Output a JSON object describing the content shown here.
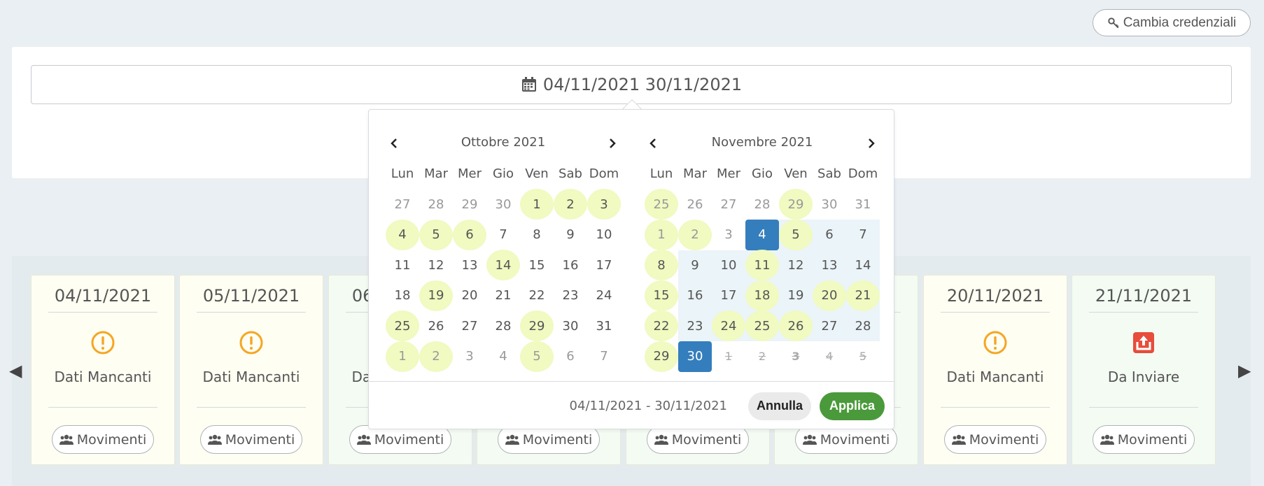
{
  "header": {
    "credentials_label": "Cambia credenziali"
  },
  "date_filter": {
    "value": "04/11/2021 30/11/2021"
  },
  "picker": {
    "left": {
      "title": "Ottobre 2021",
      "weekdays": [
        "Lun",
        "Mar",
        "Mer",
        "Gio",
        "Ven",
        "Sab",
        "Dom"
      ],
      "days": [
        {
          "d": "27",
          "s": "off"
        },
        {
          "d": "28",
          "s": "off"
        },
        {
          "d": "29",
          "s": "off"
        },
        {
          "d": "30",
          "s": "off"
        },
        {
          "d": "1",
          "s": "hl"
        },
        {
          "d": "2",
          "s": "hl"
        },
        {
          "d": "3",
          "s": "hl"
        },
        {
          "d": "4",
          "s": "hl"
        },
        {
          "d": "5",
          "s": "hl"
        },
        {
          "d": "6",
          "s": "hl"
        },
        {
          "d": "7",
          "s": ""
        },
        {
          "d": "8",
          "s": ""
        },
        {
          "d": "9",
          "s": ""
        },
        {
          "d": "10",
          "s": ""
        },
        {
          "d": "11",
          "s": ""
        },
        {
          "d": "12",
          "s": ""
        },
        {
          "d": "13",
          "s": ""
        },
        {
          "d": "14",
          "s": "hl"
        },
        {
          "d": "15",
          "s": ""
        },
        {
          "d": "16",
          "s": ""
        },
        {
          "d": "17",
          "s": ""
        },
        {
          "d": "18",
          "s": ""
        },
        {
          "d": "19",
          "s": "hl"
        },
        {
          "d": "20",
          "s": ""
        },
        {
          "d": "21",
          "s": ""
        },
        {
          "d": "22",
          "s": ""
        },
        {
          "d": "23",
          "s": ""
        },
        {
          "d": "24",
          "s": ""
        },
        {
          "d": "25",
          "s": "hl"
        },
        {
          "d": "26",
          "s": ""
        },
        {
          "d": "27",
          "s": ""
        },
        {
          "d": "28",
          "s": ""
        },
        {
          "d": "29",
          "s": "hl"
        },
        {
          "d": "30",
          "s": ""
        },
        {
          "d": "31",
          "s": ""
        },
        {
          "d": "1",
          "s": "off hl"
        },
        {
          "d": "2",
          "s": "off hl"
        },
        {
          "d": "3",
          "s": "off"
        },
        {
          "d": "4",
          "s": "off"
        },
        {
          "d": "5",
          "s": "off hl"
        },
        {
          "d": "6",
          "s": "off"
        },
        {
          "d": "7",
          "s": "off"
        }
      ]
    },
    "right": {
      "title": "Novembre 2021",
      "weekdays": [
        "Lun",
        "Mar",
        "Mer",
        "Gio",
        "Ven",
        "Sab",
        "Dom"
      ],
      "days": [
        {
          "d": "25",
          "s": "off hl"
        },
        {
          "d": "26",
          "s": "off"
        },
        {
          "d": "27",
          "s": "off"
        },
        {
          "d": "28",
          "s": "off"
        },
        {
          "d": "29",
          "s": "off hl"
        },
        {
          "d": "30",
          "s": "off"
        },
        {
          "d": "31",
          "s": "off"
        },
        {
          "d": "1",
          "s": "off hl"
        },
        {
          "d": "2",
          "s": "off hl"
        },
        {
          "d": "3",
          "s": "off"
        },
        {
          "d": "4",
          "s": "sel"
        },
        {
          "d": "5",
          "s": "hl range"
        },
        {
          "d": "6",
          "s": "range"
        },
        {
          "d": "7",
          "s": "range"
        },
        {
          "d": "8",
          "s": "hl"
        },
        {
          "d": "9",
          "s": "range"
        },
        {
          "d": "10",
          "s": "range"
        },
        {
          "d": "11",
          "s": "hl range"
        },
        {
          "d": "12",
          "s": "range"
        },
        {
          "d": "13",
          "s": "range"
        },
        {
          "d": "14",
          "s": "range"
        },
        {
          "d": "15",
          "s": "hl"
        },
        {
          "d": "16",
          "s": "range"
        },
        {
          "d": "17",
          "s": "range"
        },
        {
          "d": "18",
          "s": "hl range"
        },
        {
          "d": "19",
          "s": "range"
        },
        {
          "d": "20",
          "s": "hl range"
        },
        {
          "d": "21",
          "s": "hl range"
        },
        {
          "d": "22",
          "s": "hl"
        },
        {
          "d": "23",
          "s": "range"
        },
        {
          "d": "24",
          "s": "hl range"
        },
        {
          "d": "25",
          "s": "hl range"
        },
        {
          "d": "26",
          "s": "hl range"
        },
        {
          "d": "27",
          "s": "range"
        },
        {
          "d": "28",
          "s": "range"
        },
        {
          "d": "29",
          "s": "hl"
        },
        {
          "d": "30",
          "s": "sel"
        },
        {
          "d": "1",
          "s": "dis"
        },
        {
          "d": "2",
          "s": "dis"
        },
        {
          "d": "3",
          "s": "dis bold"
        },
        {
          "d": "4",
          "s": "dis"
        },
        {
          "d": "5",
          "s": "dis"
        }
      ]
    },
    "range_label": "04/11/2021 - 30/11/2021",
    "cancel_label": "Annulla",
    "apply_label": "Applica"
  },
  "cards": [
    {
      "date": "04/11/2021",
      "status": "Dati Mancanti",
      "icon": "warning-icon",
      "color": "yellow",
      "btn": "Movimenti"
    },
    {
      "date": "05/11/2021",
      "status": "Dati Mancanti",
      "icon": "warning-icon",
      "color": "yellow",
      "btn": "Movimenti"
    },
    {
      "date": "06/11/2021",
      "status": "Dati Mancanti",
      "icon": "",
      "color": "green",
      "btn": "Movimenti"
    },
    {
      "date": "",
      "status": "",
      "icon": "",
      "color": "green",
      "btn": "Movimenti"
    },
    {
      "date": "",
      "status": "",
      "icon": "",
      "color": "green",
      "btn": "Movimenti"
    },
    {
      "date": "",
      "status": "",
      "icon": "",
      "color": "green",
      "btn": "Movimenti"
    },
    {
      "date": "20/11/2021",
      "status": "Dati Mancanti",
      "icon": "warning-icon",
      "color": "yellow",
      "btn": "Movimenti"
    },
    {
      "date": "21/11/2021",
      "status": "Da Inviare",
      "icon": "upload-icon",
      "color": "green",
      "btn": "Movimenti"
    }
  ],
  "colors": {
    "accent_selected": "#357ebd",
    "apply_green": "#4a9a3b",
    "highlight": "#f0fac1",
    "warning": "#f5a623",
    "upload_red": "#e74c3c"
  }
}
